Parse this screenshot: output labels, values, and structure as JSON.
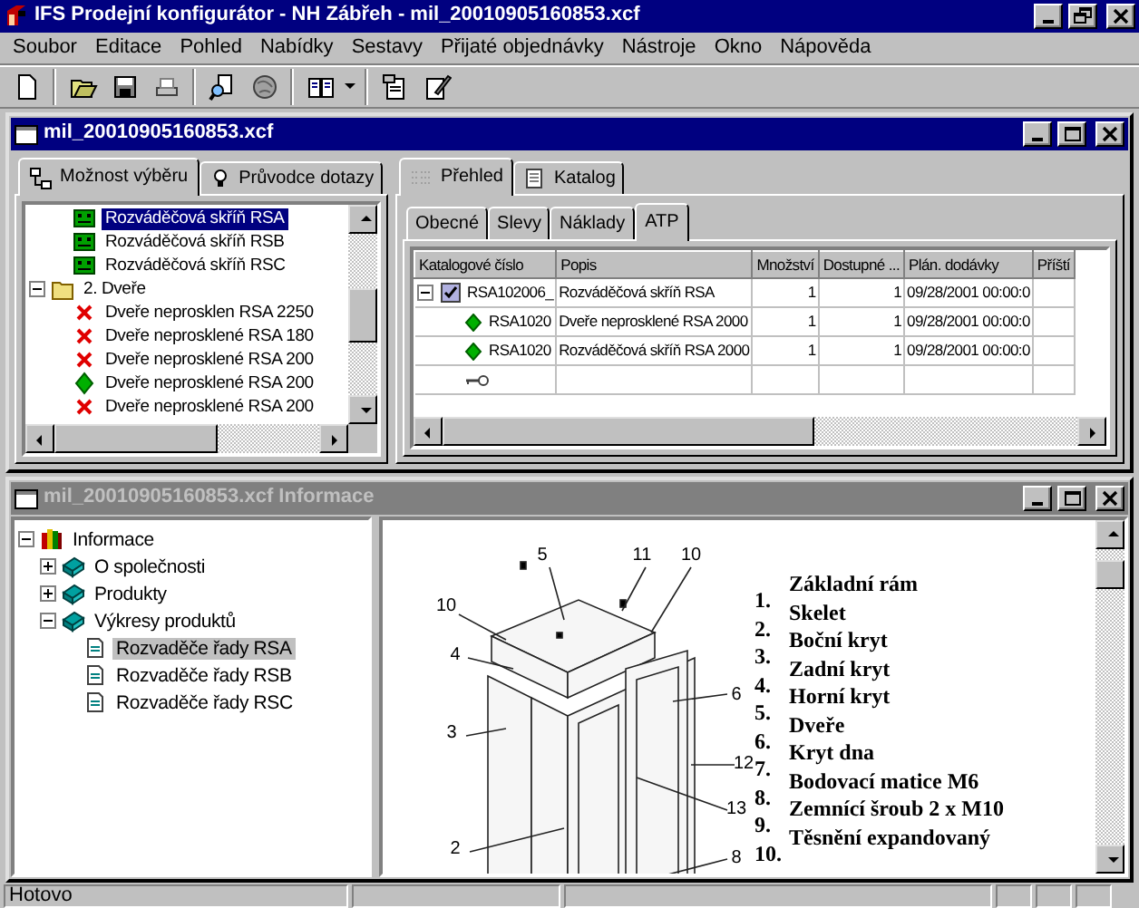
{
  "window": {
    "title": "IFS Prodejní konfigurátor - NH Zábřeh - mil_20010905160853.xcf"
  },
  "menu": [
    "Soubor",
    "Editace",
    "Pohled",
    "Nabídky",
    "Sestavy",
    "Přijaté objednávky",
    "Nástroje",
    "Okno",
    "Nápověda"
  ],
  "config_window": {
    "title": "mil_20010905160853.xcf",
    "side_tabs": [
      {
        "label": "Možnost výběru",
        "selected": true
      },
      {
        "label": "Průvodce dotazy",
        "selected": false
      }
    ],
    "options_tree": [
      {
        "children": [
          {
            "kind": "cabinet",
            "label": "Rozváděčová skříň RSA",
            "selected": true
          },
          {
            "kind": "cabinet",
            "label": "Rozváděčová skříň RSB",
            "selected": false
          },
          {
            "kind": "cabinet",
            "label": "Rozváděčová skříň RSC",
            "selected": false
          }
        ]
      },
      {
        "kind": "folder",
        "label": "2. Dveře",
        "expanded": true,
        "selected": false,
        "children": [
          {
            "kind": "excluded",
            "label": "Dveře neprosklen RSA 2250",
            "selected": false
          },
          {
            "kind": "excluded",
            "label": "Dveře neprosklené RSA 180",
            "selected": false
          },
          {
            "kind": "excluded",
            "label": "Dveře neprosklené RSA 200",
            "selected": false
          },
          {
            "kind": "available",
            "label": "Dveře neprosklené RSA 200",
            "selected": false
          },
          {
            "kind": "excluded",
            "label": "Dveře neprosklené RSA 200",
            "selected": false
          }
        ]
      }
    ],
    "main_tabs": [
      {
        "label": "Přehled",
        "selected": true
      },
      {
        "label": "Katalog",
        "selected": false
      }
    ],
    "sub_tabs": [
      {
        "label": "Obecné",
        "selected": false
      },
      {
        "label": "Slevy",
        "selected": false
      },
      {
        "label": "Náklady",
        "selected": false
      },
      {
        "label": "ATP",
        "selected": true
      }
    ],
    "table": {
      "columns": [
        "Katalogové číslo",
        "Popis",
        "Množství",
        "Dostupné ...",
        "Plán. dodávky",
        "Příští"
      ],
      "rows": [
        {
          "kind": "parent",
          "expanded": true,
          "checked": true,
          "cells": [
            "RSA102006_",
            "Rozváděčová skříň RSA",
            "1",
            "1",
            "09/28/2001 00:00:0"
          ]
        },
        {
          "kind": "child",
          "cells": [
            "RSA1020",
            "Dveře neprosklené RSA 2000",
            "1",
            "1",
            "09/28/2001 00:00:0"
          ]
        },
        {
          "kind": "child",
          "cells": [
            "RSA1020",
            "Rozváděčová skříň RSA 2000",
            "1",
            "1",
            "09/28/2001 00:00:0"
          ]
        },
        {
          "kind": "new"
        }
      ]
    }
  },
  "info_window": {
    "title": "mil_20010905160853.xcf Informace",
    "tree": [
      {
        "kind": "books",
        "label": "Informace",
        "expanded": true,
        "selected": false,
        "children": [
          {
            "kind": "book",
            "label": "O společnosti",
            "expanded": false,
            "selected": false
          },
          {
            "kind": "book",
            "label": "Produkty",
            "expanded": false,
            "selected": false
          },
          {
            "kind": "book",
            "label": "Výkresy produktů",
            "expanded": true,
            "selected": false,
            "children": [
              {
                "kind": "document",
                "label": "Rozvaděče řady RSA",
                "selected": true
              },
              {
                "kind": "document",
                "label": "Rozvaděče řady RSB",
                "selected": false
              },
              {
                "kind": "document",
                "label": "Rozvaděče řady RSC",
                "selected": false
              }
            ]
          }
        ]
      }
    ],
    "drawing": {
      "callouts": [
        "5",
        "11",
        "10",
        "10",
        "4",
        "3",
        "6",
        "12",
        "13",
        "2",
        "8"
      ],
      "legend": [
        {
          "number": "1.",
          "text": "Základní rám"
        },
        {
          "number": "2.",
          "text": "Skelet"
        },
        {
          "number": "3.",
          "text": "Boční kryt"
        },
        {
          "number": "4.",
          "text": "Zadní kryt"
        },
        {
          "number": "5.",
          "text": "Horní kryt"
        },
        {
          "number": "6.",
          "text": "Dveře"
        },
        {
          "number": "7.",
          "text": "Kryt dna"
        },
        {
          "number": "8.",
          "text": "Bodovací matice M6"
        },
        {
          "number": "9.",
          "text": "Zemnící šroub 2 x M10"
        },
        {
          "number": "10.",
          "text": "Těsnění expandovaný"
        }
      ]
    }
  },
  "status_bar": {
    "text": "Hotovo"
  }
}
